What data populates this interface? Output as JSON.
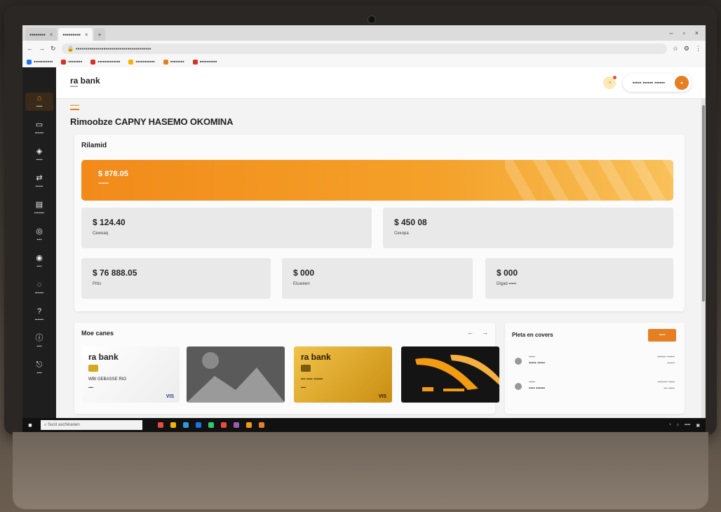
{
  "browser": {
    "tabs": [
      {
        "label": "▪▪▪▪▪▪▪▪",
        "active": false
      },
      {
        "label": "▪▪▪▪▪▪▪▪▪",
        "active": true
      }
    ],
    "new_tab": "+",
    "url": "▪▪▪▪▪▪▪▪▪▪▪▪▪▪▪▪▪▪▪▪▪▪▪▪▪▪▪▪▪▪▪▪▪▪▪▪▪▪",
    "bookmarks": [
      {
        "label": "▪▪▪▪▪▪▪▪▪▪▪",
        "color": "#1a73e8"
      },
      {
        "label": "▪▪▪▪▪▪▪▪",
        "color": "#d93025"
      },
      {
        "label": "▪▪▪▪▪▪▪▪▪▪▪▪▪",
        "color": "#d93025"
      },
      {
        "label": "▪▪▪▪▪▪▪▪▪▪▪",
        "color": "#f4b400"
      },
      {
        "label": "▪▪▪▪▪▪▪▪",
        "color": "#e67e22"
      },
      {
        "label": "▪▪▪▪▪▪▪▪▪▪",
        "color": "#d93025"
      }
    ]
  },
  "app": {
    "logo": "ra bank",
    "logo_sub": "▪▪▪▪▪",
    "user_name": "▪▪▪▪▪ ▪▪▪▪▪▪ ▪▪▪▪▪▪",
    "avatar_initial": "▪",
    "accent": "#e67e22",
    "breadcrumb": "▪▪▪▪▪▪",
    "page_title": "Rimoobze CAPNY HASEMO OKOMINA",
    "sidebar": [
      {
        "icon": "home-icon",
        "glyph": "⌂",
        "label": "▪▪▪▪▪",
        "active": true
      },
      {
        "icon": "card-icon",
        "glyph": "▭",
        "label": "▪▪▪▪▪▪▪",
        "active": false
      },
      {
        "icon": "wallet-icon",
        "glyph": "◈",
        "label": "▪▪▪▪▪",
        "active": false
      },
      {
        "icon": "transfer-icon",
        "glyph": "⇄",
        "label": "▪▪▪▪▪▪",
        "active": false
      },
      {
        "icon": "chart-icon",
        "glyph": "▤",
        "label": "▪▪▪▪▪▪▪▪",
        "active": false
      },
      {
        "icon": "settings-icon",
        "glyph": "◎",
        "label": "▪▪▪▪",
        "active": false
      },
      {
        "icon": "user-icon",
        "glyph": "◉",
        "label": "▪▪▪▪",
        "active": false
      },
      {
        "icon": "bell-icon",
        "glyph": "◌",
        "label": "▪▪▪▪▪▪▪",
        "active": false
      },
      {
        "icon": "help-icon",
        "glyph": "?",
        "label": "▪▪▪▪▪▪▪",
        "active": false
      },
      {
        "icon": "info-icon",
        "glyph": "ⓘ",
        "label": "▪▪▪▪",
        "active": false
      },
      {
        "icon": "logout-icon",
        "glyph": "⎋",
        "label": "▪▪▪▪",
        "active": false
      }
    ],
    "balances": {
      "title": "Rilamid",
      "hero": {
        "amount": "$ 878.05",
        "label": "▪▪▪▪▪▪▪"
      },
      "stats": [
        {
          "amount": "$ 124.40",
          "label": "Cewoaq"
        },
        {
          "amount": "$ 450 08",
          "label": "Cexopa"
        },
        {
          "amount": "$ 76 888.05",
          "label": "Prbs"
        },
        {
          "amount": "$ 000",
          "label": "Elcareen"
        },
        {
          "amount": "$ 000",
          "label": "Digad ▪▪▪▪▪"
        }
      ]
    },
    "cards": {
      "title": "Moe canes",
      "prev": "←",
      "next": "→",
      "items": [
        {
          "brand": "ra bank",
          "number": "WBI GEBASSE RIO",
          "expiry": "▪▪▪▪",
          "network": "VIS"
        },
        {
          "brand": "",
          "number": "",
          "expiry": "",
          "network": ""
        },
        {
          "brand": "ra bank",
          "number": "▪▪▪ ▪▪▪▪ ▪▪▪▪▪▪",
          "expiry": "▪▪▪▪",
          "network": "VIS"
        },
        {
          "brand": "",
          "number": "",
          "expiry": "",
          "network": ""
        }
      ]
    },
    "payments": {
      "title": "Pleta en covers",
      "button": "▪▪▪▪",
      "rows": [
        {
          "t1": "▪▪▪▪▪",
          "t2": "▪▪▪▪▪ ▪▪▪▪▪",
          "r1": "▪▪▪▪▪▪▪ ▪▪▪▪▪▪",
          "r2": "▪▪▪▪▪▪"
        },
        {
          "t1": "▪▪▪▪▪",
          "t2": "▪▪▪▪ ▪▪▪▪▪▪",
          "r1": "▪▪▪▪▪▪▪▪ ▪▪▪▪▪",
          "r2": "▪▪▪ ▪▪▪▪▪"
        }
      ]
    }
  },
  "taskbar": {
    "search_placeholder": "Sucit aschinanen",
    "apps": [
      "#e74c3c",
      "#f4b400",
      "#3498db",
      "#1a73e8",
      "#2ecc71",
      "#e74c3c",
      "#9b59b6",
      "#f39c12",
      "#e67e22"
    ],
    "tray_time": "▪▪▪▪"
  }
}
